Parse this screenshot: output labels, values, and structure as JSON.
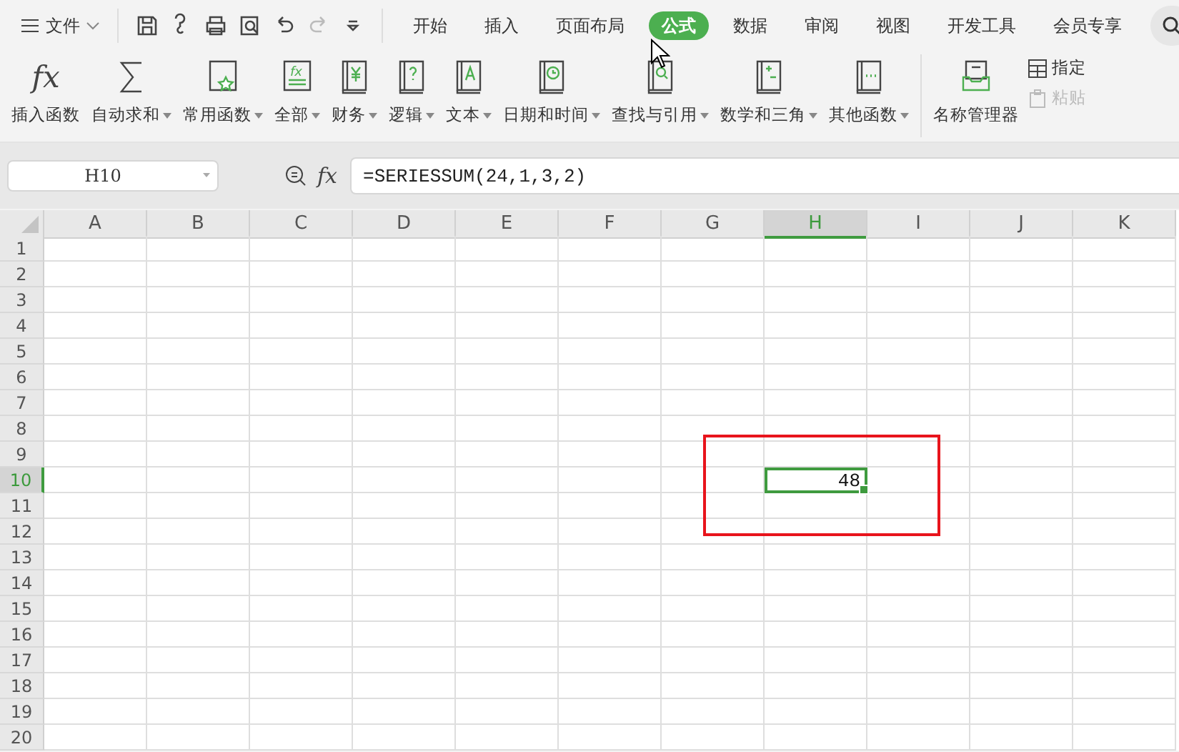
{
  "menu": {
    "file_label": "文件",
    "tabs": [
      {
        "label": "开始",
        "selected": false
      },
      {
        "label": "插入",
        "selected": false
      },
      {
        "label": "页面布局",
        "selected": false
      },
      {
        "label": "公式",
        "selected": true
      },
      {
        "label": "数据",
        "selected": false
      },
      {
        "label": "审阅",
        "selected": false
      },
      {
        "label": "视图",
        "selected": false
      },
      {
        "label": "开发工具",
        "selected": false
      },
      {
        "label": "会员专享",
        "selected": false
      }
    ]
  },
  "ribbon": {
    "groups": [
      {
        "kind": "fx",
        "symbol": "fx",
        "label": "插入函数",
        "dropdown": false
      },
      {
        "kind": "sum",
        "label": "自动求和",
        "dropdown": true
      },
      {
        "kind": "star",
        "label": "常用函数",
        "dropdown": true
      },
      {
        "kind": "fxbook",
        "label": "全部",
        "dropdown": true
      },
      {
        "kind": "yen",
        "label": "财务",
        "dropdown": true
      },
      {
        "kind": "question",
        "label": "逻辑",
        "dropdown": true
      },
      {
        "kind": "letter",
        "label": "文本",
        "dropdown": true
      },
      {
        "kind": "clock",
        "label": "日期和时间",
        "dropdown": true
      },
      {
        "kind": "magnifier",
        "label": "查找与引用",
        "dropdown": true
      },
      {
        "kind": "math",
        "label": "数学和三角",
        "dropdown": true
      },
      {
        "kind": "dots",
        "label": "其他函数",
        "dropdown": true
      }
    ],
    "name_manager": "名称管理器",
    "small_buttons": [
      {
        "label": "指定",
        "disabled": false
      },
      {
        "label": "粘贴",
        "disabled": true
      }
    ]
  },
  "name_box": "H10",
  "formula_symbol": "fx",
  "formula": "=SERIESSUM(24,1,3,2)",
  "sheet": {
    "columns": [
      {
        "label": "A",
        "selected": false
      },
      {
        "label": "B",
        "selected": false
      },
      {
        "label": "C",
        "selected": false
      },
      {
        "label": "D",
        "selected": false
      },
      {
        "label": "E",
        "selected": false
      },
      {
        "label": "F",
        "selected": false
      },
      {
        "label": "G",
        "selected": false
      },
      {
        "label": "H",
        "selected": true
      },
      {
        "label": "I",
        "selected": false
      },
      {
        "label": "J",
        "selected": false
      },
      {
        "label": "K",
        "selected": false
      }
    ],
    "rows": [
      {
        "label": "1",
        "selected": false
      },
      {
        "label": "2",
        "selected": false
      },
      {
        "label": "3",
        "selected": false
      },
      {
        "label": "4",
        "selected": false
      },
      {
        "label": "5",
        "selected": false
      },
      {
        "label": "6",
        "selected": false
      },
      {
        "label": "7",
        "selected": false
      },
      {
        "label": "8",
        "selected": false
      },
      {
        "label": "9",
        "selected": false
      },
      {
        "label": "10",
        "selected": true,
        "value": "48"
      },
      {
        "label": "11",
        "selected": false
      },
      {
        "label": "12",
        "selected": false
      },
      {
        "label": "13",
        "selected": false
      },
      {
        "label": "14",
        "selected": false
      },
      {
        "label": "15",
        "selected": false
      },
      {
        "label": "16",
        "selected": false
      },
      {
        "label": "17",
        "selected": false
      },
      {
        "label": "18",
        "selected": false
      },
      {
        "label": "19",
        "selected": false
      },
      {
        "label": "20",
        "selected": false
      }
    ]
  }
}
